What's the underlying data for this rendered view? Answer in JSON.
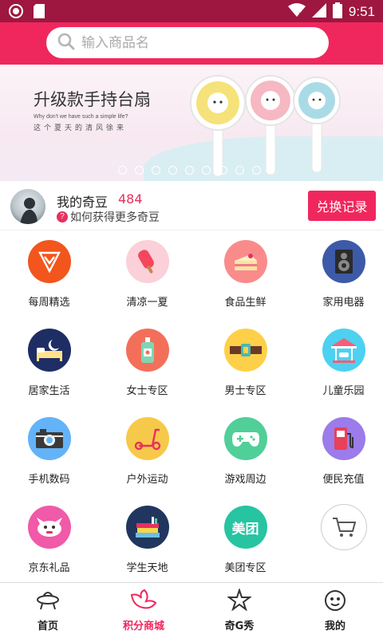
{
  "status_bar": {
    "time": "9:51"
  },
  "search": {
    "placeholder": "输入商品名"
  },
  "banner": {
    "title": "升级款手持台扇",
    "subtitle_en": "Why don't we have such a simple life?",
    "subtitle_cn": "这个夏天的清风徐来",
    "dot_count": 9
  },
  "user": {
    "name": "我的奇豆",
    "points": "484",
    "help_text": "如何获得更多奇豆",
    "help_badge": "?",
    "exchange_label": "兑换记录"
  },
  "categories": [
    {
      "label": "每周精选",
      "icon": "diamond-icon",
      "color": "#f2561d"
    },
    {
      "label": "清凉一夏",
      "icon": "popsicle-icon",
      "color": "#fbd0d8"
    },
    {
      "label": "食品生鲜",
      "icon": "cake-icon",
      "color": "#fa8b8b"
    },
    {
      "label": "家用电器",
      "icon": "speaker-icon",
      "color": "#3d5aa9"
    },
    {
      "label": "居家生活",
      "icon": "bed-moon-icon",
      "color": "#1e2e64"
    },
    {
      "label": "女士专区",
      "icon": "lotion-bottle-icon",
      "color": "#f46f5a"
    },
    {
      "label": "男士专区",
      "icon": "belt-icon",
      "color": "#fed049"
    },
    {
      "label": "儿童乐园",
      "icon": "carousel-icon",
      "color": "#4dd1f1"
    },
    {
      "label": "手机数码",
      "icon": "camera-icon",
      "color": "#64b3f8"
    },
    {
      "label": "户外运动",
      "icon": "scooter-icon",
      "color": "#f7c94a"
    },
    {
      "label": "游戏周边",
      "icon": "gamepad-icon",
      "color": "#50cf98"
    },
    {
      "label": "便民充值",
      "icon": "fuel-pump-icon",
      "color": "#9c7bea"
    },
    {
      "label": "京东礼品",
      "icon": "jd-dog-icon",
      "color": "#f05aa8"
    },
    {
      "label": "学生天地",
      "icon": "books-icon",
      "color": "#21365f"
    },
    {
      "label": "美团专区",
      "icon": "meituan-icon",
      "color": "#27c4a2",
      "icon_text": "美团"
    },
    {
      "label": "",
      "icon": "shopping-cart-icon",
      "color": "#ffffff"
    }
  ],
  "nav": [
    {
      "label": "首页",
      "icon": "ufo-icon",
      "active": false
    },
    {
      "label": "积分商城",
      "icon": "wings-icon",
      "active": true
    },
    {
      "label": "奇G秀",
      "icon": "star-icon",
      "active": false
    },
    {
      "label": "我的",
      "icon": "profile-face-icon",
      "active": false
    }
  ],
  "colors": {
    "primary": "#f0275d",
    "status_bar": "#9e1740"
  }
}
